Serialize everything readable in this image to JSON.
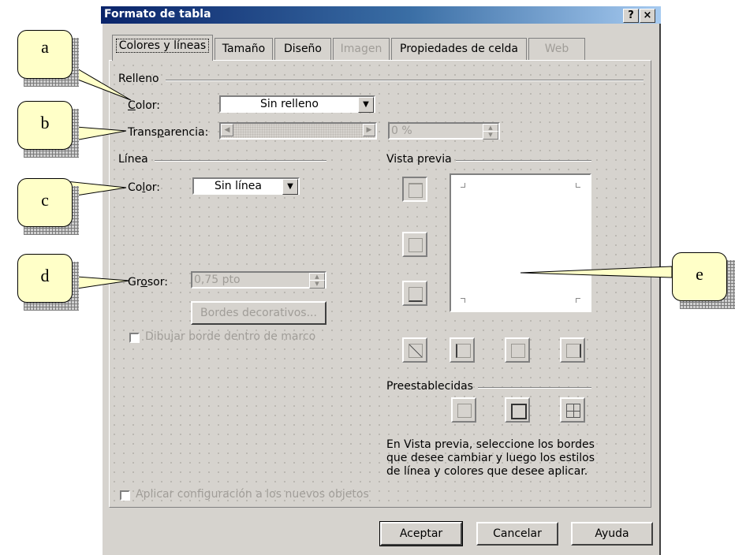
{
  "dialog": {
    "title": "Formato de tabla",
    "help_button": "?",
    "close_button": "×"
  },
  "tabs": [
    {
      "label": "Colores y líneas",
      "selected": true,
      "enabled": true
    },
    {
      "label": "Tamaño",
      "enabled": true
    },
    {
      "label": "Diseño",
      "enabled": true
    },
    {
      "label": "Imagen",
      "enabled": false
    },
    {
      "label": "Propiedades de celda",
      "enabled": true
    },
    {
      "label": "Web",
      "enabled": false
    }
  ],
  "fill": {
    "section": "Relleno",
    "color_label_pre": "",
    "color_label_ul": "C",
    "color_label_post": "olor:",
    "color_value": "Sin relleno",
    "transparency_label_pre": "Trans",
    "transparency_label_ul": "p",
    "transparency_label_post": "arencia:",
    "transparency_value": "0 %"
  },
  "line": {
    "section": "Línea",
    "color_label_pre": "Co",
    "color_label_ul": "l",
    "color_label_post": "or:",
    "color_value": "Sin línea",
    "weight_label_pre": "Gr",
    "weight_label_ul": "o",
    "weight_label_post": "sor:",
    "weight_value": "0,75 pto",
    "decorative_borders": "Bordes decorativos...",
    "draw_inside": "Dibujar borde dentro de marco"
  },
  "preview": {
    "section": "Vista previa",
    "presets_section": "Preestablecidas",
    "help_text": [
      "En Vista previa, seleccione los bordes",
      "que desee cambiar y luego los estilos",
      "de línea y colores que desee aplicar."
    ]
  },
  "apply_defaults": "Aplicar configuración a los nuevos objetos",
  "buttons": {
    "ok": "Aceptar",
    "cancel": "Cancelar",
    "help": "Ayuda"
  },
  "callouts": [
    "a",
    "b",
    "c",
    "d",
    "e"
  ],
  "colors": {
    "title_start": "#0a246a",
    "title_end": "#a6caf0",
    "dialog_bg": "#d6d3ce",
    "callout_fill": "#ffffc8",
    "disabled_text": "#a09d98"
  }
}
